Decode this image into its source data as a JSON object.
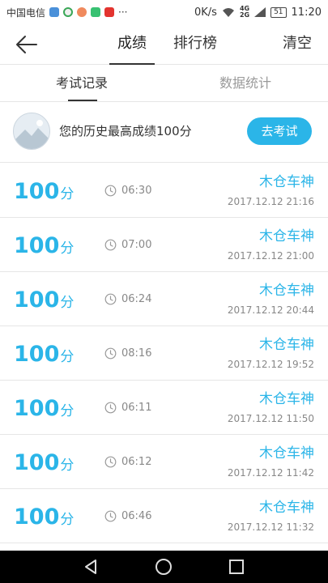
{
  "status_bar": {
    "carrier": "中国电信",
    "more": "···",
    "speed": "0K/s",
    "signal_top": "4G",
    "signal_bottom": "2G",
    "battery": "51",
    "time": "11:20"
  },
  "header": {
    "tab_score": "成绩",
    "tab_rank": "排行榜",
    "clear": "清空"
  },
  "subtabs": {
    "records": "考试记录",
    "stats": "数据统计"
  },
  "best": {
    "text": "您的历史最高成绩100分",
    "button": "去考试"
  },
  "records": [
    {
      "score": "100",
      "unit": "分",
      "duration": "06:30",
      "name": "木仓车神",
      "date": "2017.12.12  21:16"
    },
    {
      "score": "100",
      "unit": "分",
      "duration": "07:00",
      "name": "木仓车神",
      "date": "2017.12.12  21:00"
    },
    {
      "score": "100",
      "unit": "分",
      "duration": "06:24",
      "name": "木仓车神",
      "date": "2017.12.12  20:44"
    },
    {
      "score": "100",
      "unit": "分",
      "duration": "08:16",
      "name": "木仓车神",
      "date": "2017.12.12  19:52"
    },
    {
      "score": "100",
      "unit": "分",
      "duration": "06:11",
      "name": "木仓车神",
      "date": "2017.12.12  11:50"
    },
    {
      "score": "100",
      "unit": "分",
      "duration": "06:12",
      "name": "木仓车神",
      "date": "2017.12.12  11:42"
    },
    {
      "score": "100",
      "unit": "分",
      "duration": "06:46",
      "name": "木仓车神",
      "date": "2017.12.12  11:32"
    }
  ],
  "colors": {
    "accent": "#2bb5e8",
    "text": "#333333",
    "muted": "#888888",
    "divider": "#e6e6e6"
  },
  "icons": {
    "back": "arrow-left-icon",
    "clock": "clock-icon",
    "nav_back": "triangle-back-icon",
    "nav_home": "circle-home-icon",
    "nav_recent": "square-recent-icon"
  }
}
